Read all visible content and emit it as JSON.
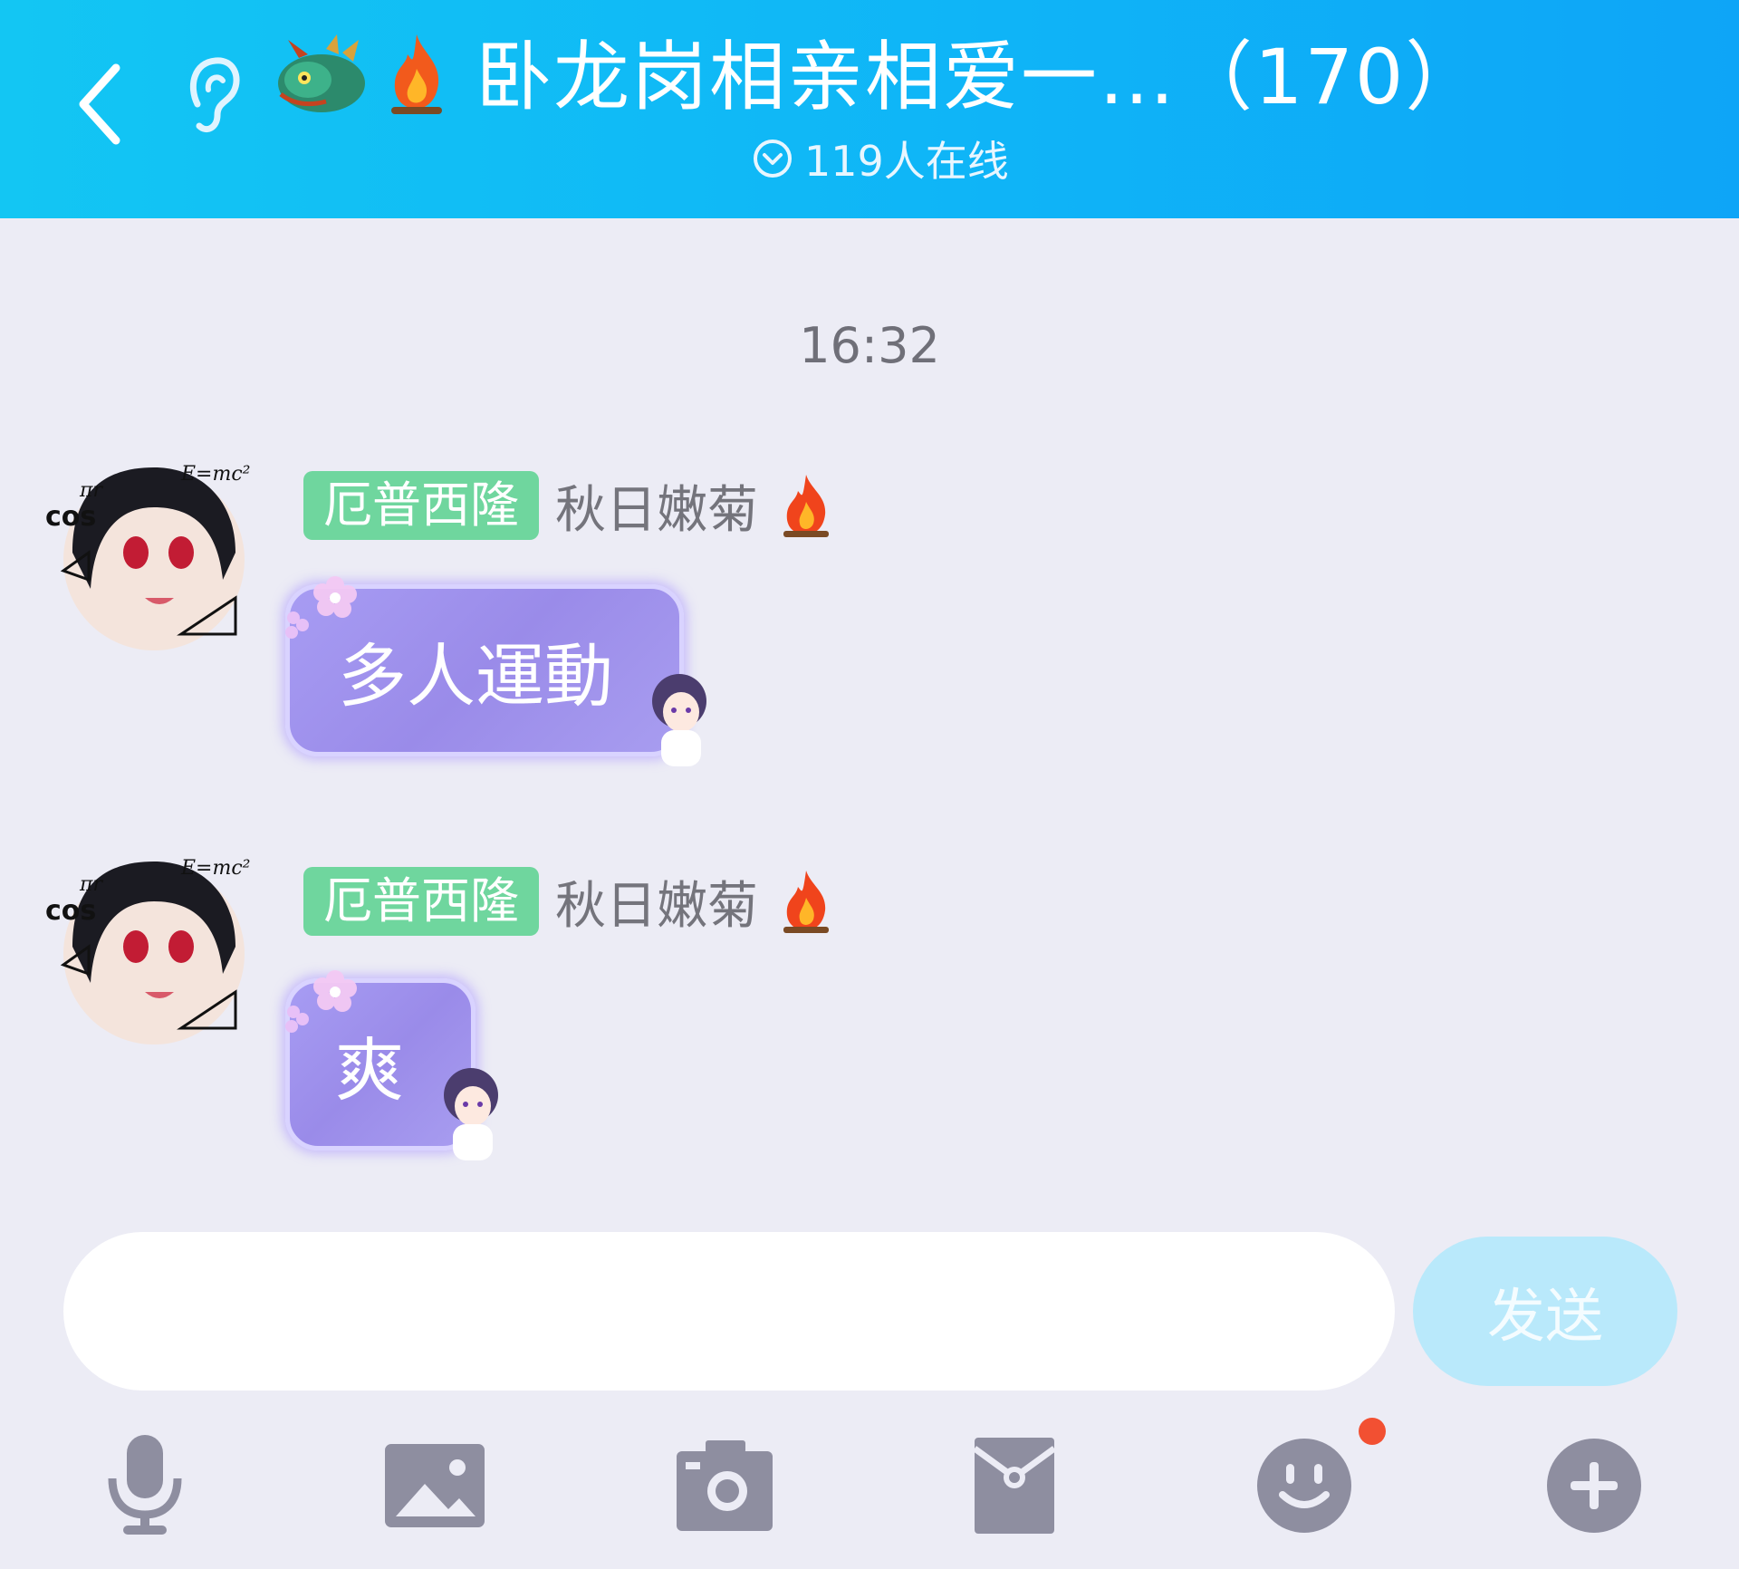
{
  "header": {
    "title": "卧龙岗相亲相爱一…（170）",
    "online_text": "119人在线",
    "background": "#0fb5f7"
  },
  "chat": {
    "timestamp": "16:32",
    "messages": [
      {
        "badge": "厄普西隆",
        "sender": "秋日嫩菊",
        "text": "多人運動"
      },
      {
        "badge": "厄普西隆",
        "sender": "秋日嫩菊",
        "text": "爽"
      }
    ]
  },
  "input": {
    "value": "",
    "send_label": "发送"
  },
  "toolbar": {
    "items": [
      "microphone-icon",
      "image-icon",
      "camera-icon",
      "red-packet-icon",
      "emoji-icon",
      "plus-icon"
    ],
    "notification_color": "#f25032"
  },
  "colors": {
    "badge": "#6fd69e",
    "bubble": "#9a8be9",
    "icon_gray": "#8e8ea0"
  }
}
